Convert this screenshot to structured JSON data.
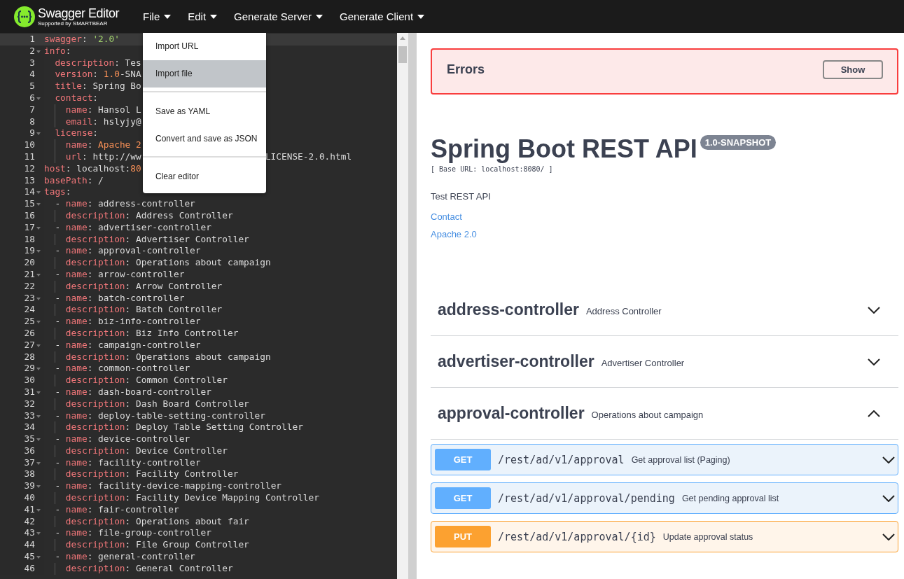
{
  "topbar": {
    "logo_title": "Swagger Editor",
    "logo_subtitle": "Supported by SMARTBEAR",
    "menus": [
      "File",
      "Edit",
      "Generate Server",
      "Generate Client"
    ]
  },
  "file_menu": [
    [
      {
        "label": "Import URL",
        "selected": false
      },
      {
        "label": "Import file",
        "selected": true
      }
    ],
    [
      {
        "label": "Save as YAML",
        "selected": false
      },
      {
        "label": "Convert and save as JSON",
        "selected": false
      }
    ],
    [
      {
        "label": "Clear editor",
        "selected": false
      }
    ]
  ],
  "editor": {
    "lines": [
      {
        "n": "1",
        "key": "swagger",
        "sep": ":",
        "parts": [
          {
            "t": "'2.0'",
            "kind": "string"
          }
        ],
        "active": true
      },
      {
        "n": "2",
        "key": "info",
        "sep": ":",
        "active": false,
        "children": [
          {
            "n": "3",
            "key": "description",
            "sep": ":",
            "parts": [
              {
                "t": "Tes",
                "kind": "plain"
              }
            ],
            "active": false
          },
          {
            "n": "4",
            "key": "version",
            "sep": ":",
            "parts": [
              {
                "t": "1.0",
                "kind": "number"
              },
              {
                "t": "-SNA",
                "kind": "plain"
              }
            ],
            "active": false
          },
          {
            "n": "5",
            "key": "title",
            "sep": ":",
            "parts": [
              {
                "t": "Spring Bo",
                "kind": "plain"
              }
            ],
            "active": false
          },
          {
            "n": "6",
            "key": "contact",
            "sep": ":",
            "active": false,
            "children": [
              {
                "n": "7",
                "key": "name",
                "sep": ":",
                "parts": [
                  {
                    "t": "Hansol L",
                    "kind": "plain"
                  }
                ],
                "active": false
              },
              {
                "n": "8",
                "key": "email",
                "sep": ":",
                "parts": [
                  {
                    "t": "hslyjy@",
                    "kind": "plain"
                  }
                ],
                "active": false
              }
            ]
          },
          {
            "n": "9",
            "key": "license",
            "sep": ":",
            "active": false,
            "children": [
              {
                "n": "10",
                "key": "name",
                "sep": ":",
                "parts": [
                  {
                    "t": "Apache 2",
                    "kind": "number"
                  }
                ],
                "active": false
              },
              {
                "n": "11",
                "key": "url",
                "sep": ":",
                "parts": [
                  {
                    "t": "http://ww",
                    "kind": "plain"
                  }
                ],
                "tail": "LICENSE-2.0.html",
                "active": false
              }
            ]
          }
        ]
      },
      {
        "n": "12",
        "key": "host",
        "sep": ":",
        "parts": [
          {
            "t": "localhost:",
            "kind": "plain"
          },
          {
            "t": "80",
            "kind": "number"
          }
        ],
        "active": false
      },
      {
        "n": "13",
        "key": "basePath",
        "sep": ":",
        "parts": [
          {
            "t": "/",
            "kind": "plain"
          }
        ],
        "active": false
      },
      {
        "n": "14",
        "key": "tags",
        "sep": ":",
        "active": false,
        "children": [
          {
            "n": "15",
            "bullet": "-",
            "key": "name",
            "sep": ":",
            "parts": [
              {
                "t": "address-controller",
                "kind": "plain"
              }
            ],
            "active": false,
            "children": [
              {
                "n": "16",
                "key": "description",
                "sep": ":",
                "parts": [
                  {
                    "t": "Address Controller",
                    "kind": "plain"
                  }
                ],
                "active": false
              }
            ]
          },
          {
            "n": "17",
            "bullet": "-",
            "key": "name",
            "sep": ":",
            "parts": [
              {
                "t": "advertiser-controller",
                "kind": "plain"
              }
            ],
            "active": false,
            "children": [
              {
                "n": "18",
                "key": "description",
                "sep": ":",
                "parts": [
                  {
                    "t": "Advertiser Controller",
                    "kind": "plain"
                  }
                ],
                "active": false
              }
            ]
          },
          {
            "n": "19",
            "bullet": "-",
            "key": "name",
            "sep": ":",
            "parts": [
              {
                "t": "approval-controller",
                "kind": "plain"
              }
            ],
            "active": false,
            "children": [
              {
                "n": "20",
                "key": "description",
                "sep": ":",
                "parts": [
                  {
                    "t": "Operations about campaign",
                    "kind": "plain"
                  }
                ],
                "active": false
              }
            ]
          },
          {
            "n": "21",
            "bullet": "-",
            "key": "name",
            "sep": ":",
            "parts": [
              {
                "t": "arrow-controller",
                "kind": "plain"
              }
            ],
            "active": false,
            "children": [
              {
                "n": "22",
                "key": "description",
                "sep": ":",
                "parts": [
                  {
                    "t": "Arrow Controller",
                    "kind": "plain"
                  }
                ],
                "active": false
              }
            ]
          },
          {
            "n": "23",
            "bullet": "-",
            "key": "name",
            "sep": ":",
            "parts": [
              {
                "t": "batch-controller",
                "kind": "plain"
              }
            ],
            "active": false,
            "children": [
              {
                "n": "24",
                "key": "description",
                "sep": ":",
                "parts": [
                  {
                    "t": "Batch Controller",
                    "kind": "plain"
                  }
                ],
                "active": false
              }
            ]
          },
          {
            "n": "25",
            "bullet": "-",
            "key": "name",
            "sep": ":",
            "parts": [
              {
                "t": "biz-info-controller",
                "kind": "plain"
              }
            ],
            "active": false,
            "children": [
              {
                "n": "26",
                "key": "description",
                "sep": ":",
                "parts": [
                  {
                    "t": "Biz Info Controller",
                    "kind": "plain"
                  }
                ],
                "active": false
              }
            ]
          },
          {
            "n": "27",
            "bullet": "-",
            "key": "name",
            "sep": ":",
            "parts": [
              {
                "t": "campaign-controller",
                "kind": "plain"
              }
            ],
            "active": false,
            "children": [
              {
                "n": "28",
                "key": "description",
                "sep": ":",
                "parts": [
                  {
                    "t": "Operations about campaign",
                    "kind": "plain"
                  }
                ],
                "active": false
              }
            ]
          },
          {
            "n": "29",
            "bullet": "-",
            "key": "name",
            "sep": ":",
            "parts": [
              {
                "t": "common-controller",
                "kind": "plain"
              }
            ],
            "active": false,
            "children": [
              {
                "n": "30",
                "key": "description",
                "sep": ":",
                "parts": [
                  {
                    "t": "Common Controller",
                    "kind": "plain"
                  }
                ],
                "active": false
              }
            ]
          },
          {
            "n": "31",
            "bullet": "-",
            "key": "name",
            "sep": ":",
            "parts": [
              {
                "t": "dash-board-controller",
                "kind": "plain"
              }
            ],
            "active": false,
            "children": [
              {
                "n": "32",
                "key": "description",
                "sep": ":",
                "parts": [
                  {
                    "t": "Dash Board Controller",
                    "kind": "plain"
                  }
                ],
                "active": false
              }
            ]
          },
          {
            "n": "33",
            "bullet": "-",
            "key": "name",
            "sep": ":",
            "parts": [
              {
                "t": "deploy-table-setting-controller",
                "kind": "plain"
              }
            ],
            "active": false,
            "children": [
              {
                "n": "34",
                "key": "description",
                "sep": ":",
                "parts": [
                  {
                    "t": "Deploy Table Setting Controller",
                    "kind": "plain"
                  }
                ],
                "active": false
              }
            ]
          },
          {
            "n": "35",
            "bullet": "-",
            "key": "name",
            "sep": ":",
            "parts": [
              {
                "t": "device-controller",
                "kind": "plain"
              }
            ],
            "active": false,
            "children": [
              {
                "n": "36",
                "key": "description",
                "sep": ":",
                "parts": [
                  {
                    "t": "Device Controller",
                    "kind": "plain"
                  }
                ],
                "active": false
              }
            ]
          },
          {
            "n": "37",
            "bullet": "-",
            "key": "name",
            "sep": ":",
            "parts": [
              {
                "t": "facility-controller",
                "kind": "plain"
              }
            ],
            "active": false,
            "children": [
              {
                "n": "38",
                "key": "description",
                "sep": ":",
                "parts": [
                  {
                    "t": "Facility Controller",
                    "kind": "plain"
                  }
                ],
                "active": false
              }
            ]
          },
          {
            "n": "39",
            "bullet": "-",
            "key": "name",
            "sep": ":",
            "parts": [
              {
                "t": "facility-device-mapping-controller",
                "kind": "plain"
              }
            ],
            "active": false,
            "children": [
              {
                "n": "40",
                "key": "description",
                "sep": ":",
                "parts": [
                  {
                    "t": "Facility Device Mapping Controller",
                    "kind": "plain"
                  }
                ],
                "active": false
              }
            ]
          },
          {
            "n": "41",
            "bullet": "-",
            "key": "name",
            "sep": ":",
            "parts": [
              {
                "t": "fair-controller",
                "kind": "plain"
              }
            ],
            "active": false,
            "children": [
              {
                "n": "42",
                "key": "description",
                "sep": ":",
                "parts": [
                  {
                    "t": "Operations about fair",
                    "kind": "plain"
                  }
                ],
                "active": false
              }
            ]
          },
          {
            "n": "43",
            "bullet": "-",
            "key": "name",
            "sep": ":",
            "parts": [
              {
                "t": "file-group-controller",
                "kind": "plain"
              }
            ],
            "active": false,
            "children": [
              {
                "n": "44",
                "key": "description",
                "sep": ":",
                "parts": [
                  {
                    "t": "File Group Controller",
                    "kind": "plain"
                  }
                ],
                "active": false
              }
            ]
          },
          {
            "n": "45",
            "bullet": "-",
            "key": "name",
            "sep": ":",
            "parts": [
              {
                "t": "general-controller",
                "kind": "plain"
              }
            ],
            "active": false,
            "children": [
              {
                "n": "46",
                "key": "description",
                "sep": ":",
                "parts": [
                  {
                    "t": "General Controller",
                    "kind": "plain"
                  }
                ],
                "active": false
              }
            ]
          }
        ]
      }
    ]
  },
  "errors": {
    "title": "Errors",
    "button": "Show"
  },
  "info": {
    "title": "Spring Boot REST API",
    "version": "1.0-SNAPSHOT",
    "base_url": "[ Base URL: localhost:8080/ ]",
    "description": "Test REST API",
    "links": [
      "Contact",
      "Apache 2.0"
    ]
  },
  "tags": [
    {
      "name": "address-controller",
      "description": "Address Controller",
      "expanded": false
    },
    {
      "name": "advertiser-controller",
      "description": "Advertiser Controller",
      "expanded": false
    },
    {
      "name": "approval-controller",
      "description": "Operations about campaign",
      "expanded": true,
      "operations": [
        {
          "method": "GET",
          "path": "/rest/ad/v1/approval",
          "summary": "Get approval list (Paging)"
        },
        {
          "method": "GET",
          "path": "/rest/ad/v1/approval/pending",
          "summary": "Get pending approval list"
        },
        {
          "method": "PUT",
          "path": "/rest/ad/v1/approval/{id}",
          "summary": "Update approval status"
        }
      ]
    }
  ]
}
